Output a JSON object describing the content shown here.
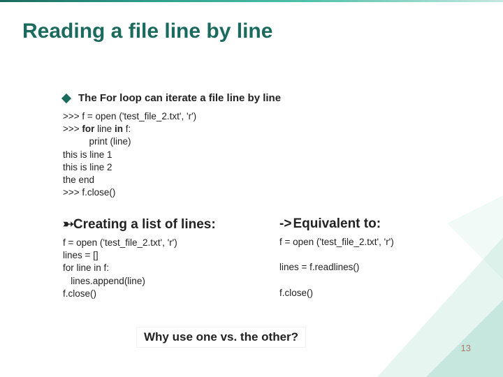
{
  "title": "Reading a file line by line",
  "bullet1": "The For loop can iterate a file line by line",
  "code1": {
    "l1a": ">>> f = open ('test_file_2.txt', 'r')",
    "l2a": ">>> ",
    "l2b": "for",
    "l2c": " line ",
    "l2d": "in",
    "l2e": " f:",
    "l3": "          print (line)",
    "l4": "this is line 1",
    "l5": "this is line 2",
    "l6": "the end",
    "l7": ">>>  f.close()"
  },
  "left_heading": "Creating a list of lines:",
  "left_code": {
    "l1": "f = open ('test_file_2.txt', 'r')",
    "l2": "lines = []",
    "l3": "for line in f:",
    "l4": "   lines.append(line)",
    "l5": "f.close()"
  },
  "right_heading": "Equivalent to:",
  "right_code": {
    "l1": "f = open ('test_file_2.txt', 'r')",
    "l2": "lines = f.readlines()",
    "l3": "f.close()"
  },
  "why": "Why use one vs. the other?",
  "page": "13"
}
